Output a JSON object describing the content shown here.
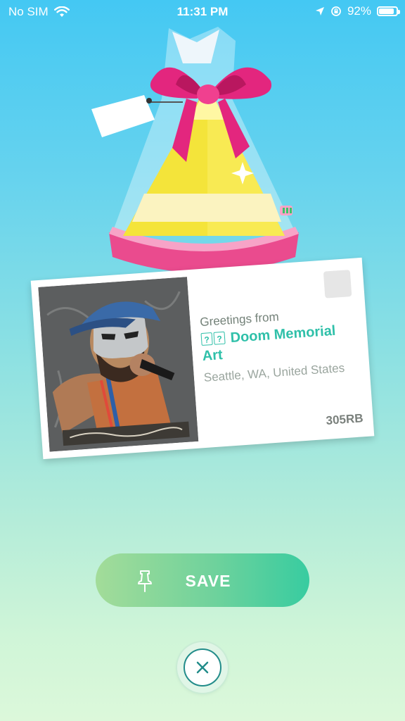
{
  "status_bar": {
    "carrier": "No SIM",
    "time": "11:31 PM",
    "battery": "92%",
    "battery_level": 0.92,
    "icons": [
      "wifi-icon",
      "location-arrow-icon",
      "orientation-lock-icon",
      "battery-icon"
    ]
  },
  "gift": {
    "icon": "gift-icon",
    "colors": {
      "bow": "#e3267e",
      "body": "#f7ea2a",
      "base": "#ec4a8c"
    }
  },
  "postcard": {
    "greeting": "Greetings from",
    "poi_prefix": "? ?",
    "poi_name": "Doom Memorial Art",
    "location": "Seattle, WA, United States",
    "distance": "305RB"
  },
  "save_button": {
    "label": "SAVE",
    "icon": "pin-icon"
  },
  "close_button": {
    "icon": "close-icon"
  },
  "colors": {
    "accent": "#2fc0a9",
    "close_border": "#228c8a"
  }
}
